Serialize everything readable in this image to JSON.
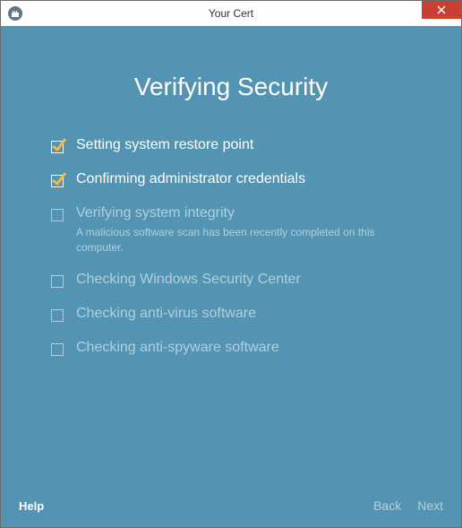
{
  "window": {
    "title": "Your Cert"
  },
  "heading": "Verifying Security",
  "steps": [
    {
      "label": "Setting system restore point",
      "done": true
    },
    {
      "label": "Confirming administrator credentials",
      "done": true
    },
    {
      "label": "Verifying system integrity",
      "done": false,
      "sub": "A malicious software scan has been recently completed on this computer."
    },
    {
      "label": "Checking Windows Security Center",
      "done": false
    },
    {
      "label": "Checking anti-virus software",
      "done": false
    },
    {
      "label": "Checking anti-spyware software",
      "done": false
    }
  ],
  "footer": {
    "help": "Help",
    "back": "Back",
    "next": "Next"
  }
}
